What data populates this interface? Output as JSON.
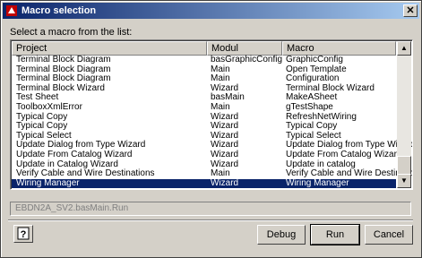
{
  "window": {
    "title": "Macro selection"
  },
  "prompt": "Select a macro from the list:",
  "columns": [
    "Project",
    "Modul",
    "Macro"
  ],
  "rows": [
    [
      "Terminal Block Diagram",
      "basGraphicConfig",
      "GraphicConfig"
    ],
    [
      "Terminal Block Diagram",
      "Main",
      "Open Template"
    ],
    [
      "Terminal Block Diagram",
      "Main",
      "Configuration"
    ],
    [
      "Terminal Block Wizard",
      "Wizard",
      "Terminal Block Wizard"
    ],
    [
      "Test Sheet",
      "basMain",
      "MakeASheet"
    ],
    [
      "ToolboxXmlError",
      "Main",
      "gTestShape"
    ],
    [
      "Typical Copy",
      "Wizard",
      "RefreshNetWiring"
    ],
    [
      "Typical Copy",
      "Wizard",
      "Typical Copy"
    ],
    [
      "Typical Select",
      "Wizard",
      "Typical Select"
    ],
    [
      "Update Dialog from Type Wizard",
      "Wizard",
      "Update Dialog from Type Wizard"
    ],
    [
      "Update From Catalog Wizard",
      "Wizard",
      "Update From Catalog Wizard"
    ],
    [
      "Update in Catalog Wizard",
      "Wizard",
      "Update in catalog"
    ],
    [
      "Verify Cable and Wire Destinations",
      "Main",
      "Verify Cable and Wire Destinations"
    ],
    [
      "Wiring Manager",
      "Wizard",
      "Wiring Manager"
    ]
  ],
  "selected_row": 13,
  "selected_macro_path": "EBDN2A_SV2.basMain.Run",
  "buttons": {
    "help": "?",
    "debug": "Debug",
    "run": "Run",
    "cancel": "Cancel"
  },
  "icons": {
    "app": "app-icon",
    "close": "close-icon",
    "help": "help-icon"
  }
}
